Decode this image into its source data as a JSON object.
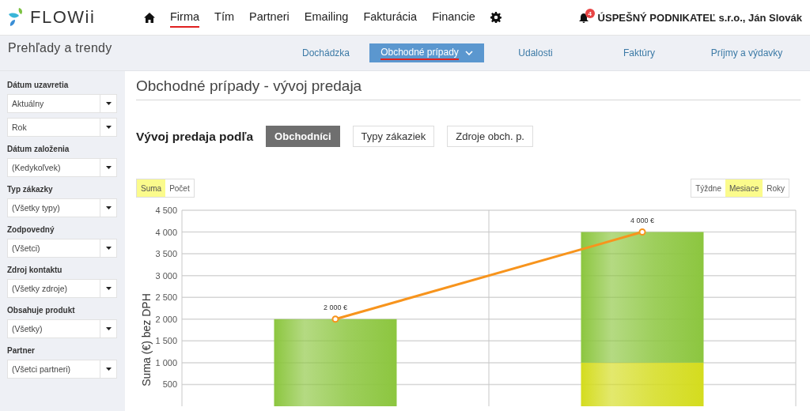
{
  "header": {
    "logo": "FLOWii",
    "nav": [
      {
        "kind": "home",
        "selected": false
      },
      {
        "kind": "text",
        "label": "Firma",
        "selected": true
      },
      {
        "kind": "text",
        "label": "Tím",
        "selected": false
      },
      {
        "kind": "text",
        "label": "Partneri",
        "selected": false
      },
      {
        "kind": "text",
        "label": "Emailing",
        "selected": false
      },
      {
        "kind": "text",
        "label": "Fakturácia",
        "selected": false
      },
      {
        "kind": "text",
        "label": "Financie",
        "selected": false
      },
      {
        "kind": "settings",
        "selected": false
      }
    ],
    "notification_count": "4",
    "account": "ÚSPEŠNÝ PODNIKATEĽ s.r.o., Ján Slovák"
  },
  "subheader": {
    "title": "Prehľady a trendy",
    "tabs": [
      {
        "label": "Dochádzka",
        "selected": false,
        "dropdown": false
      },
      {
        "label": "Obchodné prípady",
        "selected": true,
        "dropdown": true
      },
      {
        "label": "Udalosti",
        "selected": false,
        "dropdown": false
      },
      {
        "label": "Faktúry",
        "selected": false,
        "dropdown": false
      },
      {
        "label": "Príjmy a výdavky",
        "selected": false,
        "dropdown": false
      }
    ]
  },
  "sidebar": {
    "filters": [
      {
        "label": "Dátum uzavretia",
        "values": [
          "Aktuálny",
          "Rok"
        ]
      },
      {
        "label": "Dátum založenia",
        "values": [
          "(Kedykoľvek)"
        ]
      },
      {
        "label": "Typ zákazky",
        "values": [
          "(Všetky typy)"
        ]
      },
      {
        "label": "Zodpovedný",
        "values": [
          "(Všetci)"
        ]
      },
      {
        "label": "Zdroj kontaktu",
        "values": [
          "(Všetky zdroje)"
        ]
      },
      {
        "label": "Obsahuje produkt",
        "values": [
          "(Všetky)"
        ]
      },
      {
        "label": "Partner",
        "values": [
          "(Všetci partneri)"
        ]
      }
    ]
  },
  "main": {
    "title": "Obchodné prípady - vývoj predaja",
    "breakdown_label": "Vývoj predaja podľa",
    "breakdown": [
      {
        "label": "Obchodníci",
        "selected": true
      },
      {
        "label": "Typy zákaziek",
        "selected": false
      },
      {
        "label": "Zdroje obch. p.",
        "selected": false
      }
    ],
    "measure": [
      {
        "label": "Suma",
        "selected": true
      },
      {
        "label": "Počet",
        "selected": false
      }
    ],
    "period": [
      {
        "label": "Týždne",
        "selected": false
      },
      {
        "label": "Mesiace",
        "selected": true
      },
      {
        "label": "Roky",
        "selected": false
      }
    ],
    "chart_data": {
      "type": "bar",
      "stacked": true,
      "grid": true,
      "ylabel": "Suma (€) bez DPH",
      "ylim": [
        0,
        4500
      ],
      "yticks": [
        {
          "value": 500,
          "label": "500"
        },
        {
          "value": 1000,
          "label": "1 000"
        },
        {
          "value": 1500,
          "label": "1 500"
        },
        {
          "value": 2000,
          "label": "2 000"
        },
        {
          "value": 2500,
          "label": "2 500"
        },
        {
          "value": 3000,
          "label": "3 000"
        },
        {
          "value": 3500,
          "label": "3 500"
        },
        {
          "value": 4000,
          "label": "4 000"
        },
        {
          "value": 4500,
          "label": "4 500"
        }
      ],
      "series": [
        {
          "type": "bar",
          "color": "#d4dc1e",
          "values": [
            0,
            1000
          ]
        },
        {
          "type": "bar",
          "color": "#8cc63f",
          "values": [
            2000,
            3000
          ]
        },
        {
          "type": "line",
          "color": "#f7941d",
          "marker": true,
          "values": [
            2000,
            4000
          ]
        }
      ],
      "value_labels": [
        "2 000 €",
        "4 000 €"
      ]
    }
  }
}
